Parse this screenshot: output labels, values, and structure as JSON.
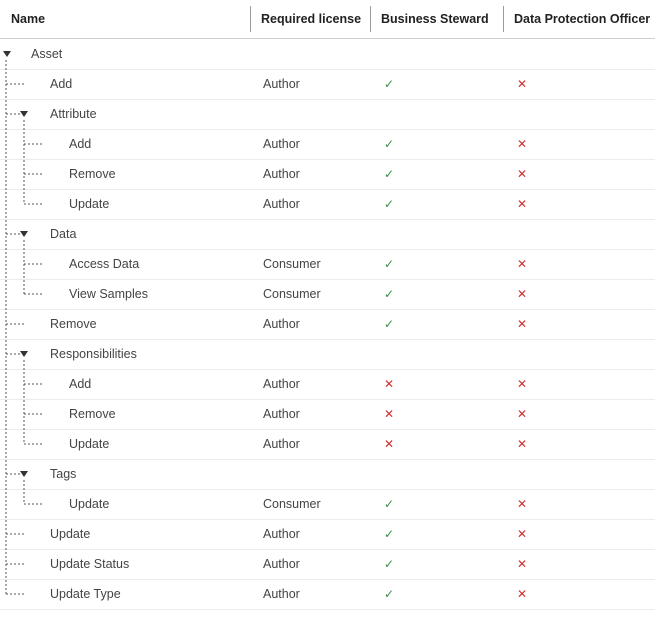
{
  "columns": {
    "name": "Name",
    "license": "Required license",
    "steward": "Business Steward",
    "dpo": "Data Protection Officer"
  },
  "icons": {
    "check": "checkmark-icon",
    "cross": "cross-icon"
  },
  "rows": [
    {
      "level": 0,
      "group": true,
      "name": "Asset"
    },
    {
      "level": 1,
      "group": false,
      "name": "Add",
      "license": "Author",
      "steward": "✓",
      "dpo": "✕"
    },
    {
      "level": 1,
      "group": true,
      "name": "Attribute"
    },
    {
      "level": 2,
      "group": false,
      "name": "Add",
      "license": "Author",
      "steward": "✓",
      "dpo": "✕"
    },
    {
      "level": 2,
      "group": false,
      "name": "Remove",
      "license": "Author",
      "steward": "✓",
      "dpo": "✕"
    },
    {
      "level": 2,
      "group": false,
      "name": "Update",
      "license": "Author",
      "steward": "✓",
      "dpo": "✕"
    },
    {
      "level": 1,
      "group": true,
      "name": "Data"
    },
    {
      "level": 2,
      "group": false,
      "name": "Access Data",
      "license": "Consumer",
      "steward": "✓",
      "dpo": "✕"
    },
    {
      "level": 2,
      "group": false,
      "name": "View Samples",
      "license": "Consumer",
      "steward": "✓",
      "dpo": "✕"
    },
    {
      "level": 1,
      "group": false,
      "name": "Remove",
      "license": "Author",
      "steward": "✓",
      "dpo": "✕"
    },
    {
      "level": 1,
      "group": true,
      "name": "Responsibilities"
    },
    {
      "level": 2,
      "group": false,
      "name": "Add",
      "license": "Author",
      "steward": "✕",
      "dpo": "✕"
    },
    {
      "level": 2,
      "group": false,
      "name": "Remove",
      "license": "Author",
      "steward": "✕",
      "dpo": "✕"
    },
    {
      "level": 2,
      "group": false,
      "name": "Update",
      "license": "Author",
      "steward": "✕",
      "dpo": "✕"
    },
    {
      "level": 1,
      "group": true,
      "name": "Tags"
    },
    {
      "level": 2,
      "group": false,
      "name": "Update",
      "license": "Consumer",
      "steward": "✓",
      "dpo": "✕"
    },
    {
      "level": 1,
      "group": false,
      "name": "Update",
      "license": "Author",
      "steward": "✓",
      "dpo": "✕"
    },
    {
      "level": 1,
      "group": false,
      "name": "Update Status",
      "license": "Author",
      "steward": "✓",
      "dpo": "✕"
    },
    {
      "level": 1,
      "group": false,
      "name": "Update Type",
      "license": "Author",
      "steward": "✓",
      "dpo": "✕"
    }
  ]
}
